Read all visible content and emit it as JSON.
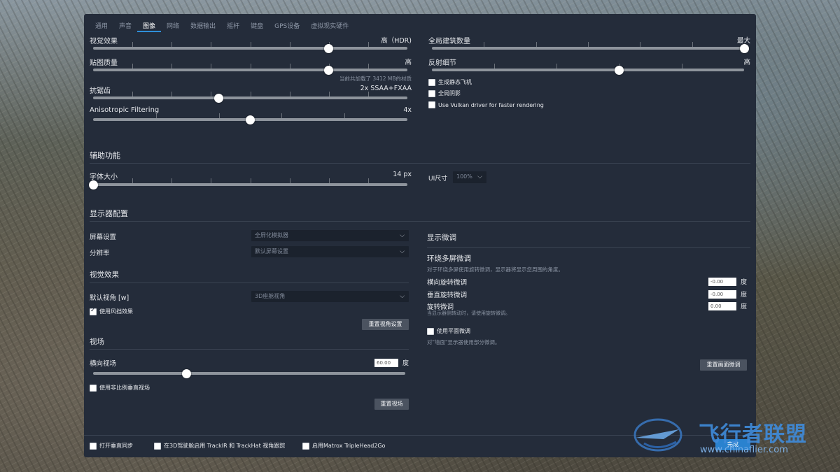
{
  "tabs": [
    "通用",
    "声音",
    "图像",
    "网络",
    "数据输出",
    "摇杆",
    "键盘",
    "GPS设备",
    "虚拟现实硬件"
  ],
  "active_tab": 2,
  "graphics": {
    "visual_effects": {
      "label": "视觉效果",
      "value": "高（HDR)",
      "level": 0.75
    },
    "texture_quality": {
      "label": "贴图质量",
      "value": "高",
      "level": 0.75,
      "note": "当前共加载了 3412 MB的材质"
    },
    "antialiasing": {
      "label": "抗锯齿",
      "value": "2x SSAA+FXAA",
      "level": 0.4
    },
    "anisotropic": {
      "label": "Anisotropic Filtering",
      "value": "4x",
      "level": 0.5
    },
    "world_objects": {
      "label": "全局建筑数量",
      "value": "最大",
      "level": 1.0
    },
    "reflection": {
      "label": "反射细节",
      "value": "高",
      "level": 0.6
    },
    "checks": [
      {
        "label": "生成静态飞机",
        "checked": false
      },
      {
        "label": "全局阴影",
        "checked": false
      },
      {
        "label": "Use Vulkan driver for faster rendering",
        "checked": false
      }
    ]
  },
  "accessibility": {
    "title": "辅助功能",
    "font_size": {
      "label": "字体大小",
      "value": "14 px",
      "level": 0.0
    },
    "ui_size": {
      "label": "UI尺寸",
      "value": "100%"
    }
  },
  "monitor": {
    "title": "显示器配置",
    "screen_setting": {
      "label": "屏幕设置",
      "value": "全屏化模拟器"
    },
    "resolution": {
      "label": "分辨率",
      "value": "默认屏幕设置"
    },
    "visual_title": "视觉效果",
    "default_view": {
      "label": "默认视角 [w]",
      "value": "3D座舱视角"
    },
    "windshield": {
      "label": "使用风挡效果",
      "checked": true
    },
    "reset_view": "重置视角设置",
    "fov_title": "视场",
    "hfov": {
      "label": "横向视场",
      "value": "60.00",
      "unit": "度",
      "level": 0.3
    },
    "nonprop": {
      "label": "使用非比例垂直视场",
      "checked": false
    },
    "reset_fov": "重置视场"
  },
  "fine_tune": {
    "title": "显示微调",
    "multi_title": "环绕多屏微调",
    "multi_desc": "对于环绕多屏使用旋转微调，显示器将显示您周围的角度。",
    "lateral": {
      "label": "横向旋转微调",
      "value": "-0.00",
      "unit": "度"
    },
    "vertical": {
      "label": "垂直旋转微调",
      "value": "-0.00",
      "unit": "度"
    },
    "roll": {
      "label": "旋转微调",
      "value": "0.00",
      "unit": "度",
      "note": "当显示器侧转动时，请使用旋转微调。"
    },
    "flat": {
      "label": "使用平面微调",
      "checked": false
    },
    "flat_desc": "对\"墙面\"显示器使用部分微调。",
    "reset": "重置画面微调"
  },
  "bottom": {
    "vsync": {
      "label": "打开垂直同步",
      "checked": false
    },
    "trackir": {
      "label": "在3D驾驶舱启用 TrackIR 和 TrackHat 视角跟踪",
      "checked": false
    },
    "matrox": {
      "label": "启用Matrox TripleHead2Go",
      "checked": false
    },
    "done": "完成"
  },
  "watermark": {
    "text": "飞行者联盟",
    "url": "www.chinaflier.com"
  },
  "colors": {
    "panel": "#242c3a",
    "accent": "#2f8fd8",
    "button": "#4b5360"
  }
}
